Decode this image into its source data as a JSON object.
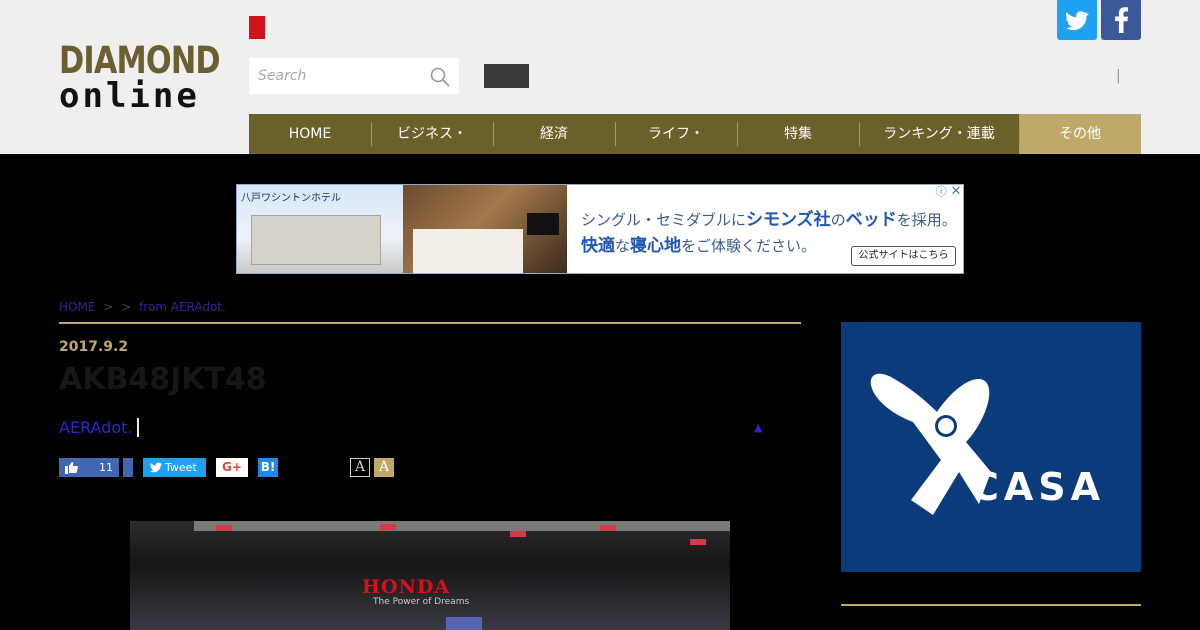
{
  "logo": {
    "line1": "DIAMOND",
    "line2": "online"
  },
  "search": {
    "placeholder": "Search",
    "icon": "search-icon"
  },
  "social": {
    "twitter_icon": "twitter-icon",
    "facebook_icon": "facebook-icon",
    "separator": "|"
  },
  "nav": {
    "items": [
      {
        "label": "HOME"
      },
      {
        "label": "ビジネス・"
      },
      {
        "label": "経済"
      },
      {
        "label": "ライフ・"
      },
      {
        "label": "特集"
      },
      {
        "label": "ランキング・連載"
      },
      {
        "label": "その他"
      }
    ]
  },
  "ad": {
    "hotel_name": "八戸ワシントンホテル",
    "line1_pre": "シングル・セミダブルに",
    "line1_brand": "シモンズ社",
    "line1_mid": "の",
    "line1_item": "ベッド",
    "line1_post": "を採用。",
    "line2_a": "快適",
    "line2_b": "な",
    "line2_c": "寝心地",
    "line2_d": "をご体験ください。",
    "cta": "公式サイトはこちら",
    "info": "ⓘ",
    "close": "✕"
  },
  "article": {
    "breadcrumb": [
      "HOME",
      ">",
      ">",
      "from AERAdot."
    ],
    "date": "2017.9.2",
    "title": "AKB48JKT48",
    "author": "AERAdot.",
    "up_arrow": "▲",
    "share": {
      "like_count": "11",
      "tweet": "Tweet",
      "gplus": "G+",
      "hatena": "B!",
      "font_small": "A",
      "font_large": "A"
    },
    "photo": {
      "sign": "HONDA",
      "slogan": "The Power of Dreams"
    }
  },
  "sidebar": {
    "ad_brand": "CASA",
    "ad_reg": "®"
  },
  "colors": {
    "header_bg": "#efefef",
    "nav_bg": "#6b5f2a",
    "nav_active": "#bfa96a",
    "accent_gold": "#bfa96a",
    "link_blue": "#2a2ad0",
    "twitter": "#1da1f2",
    "facebook": "#3b5998",
    "casa_blue": "#0c3b7c"
  }
}
